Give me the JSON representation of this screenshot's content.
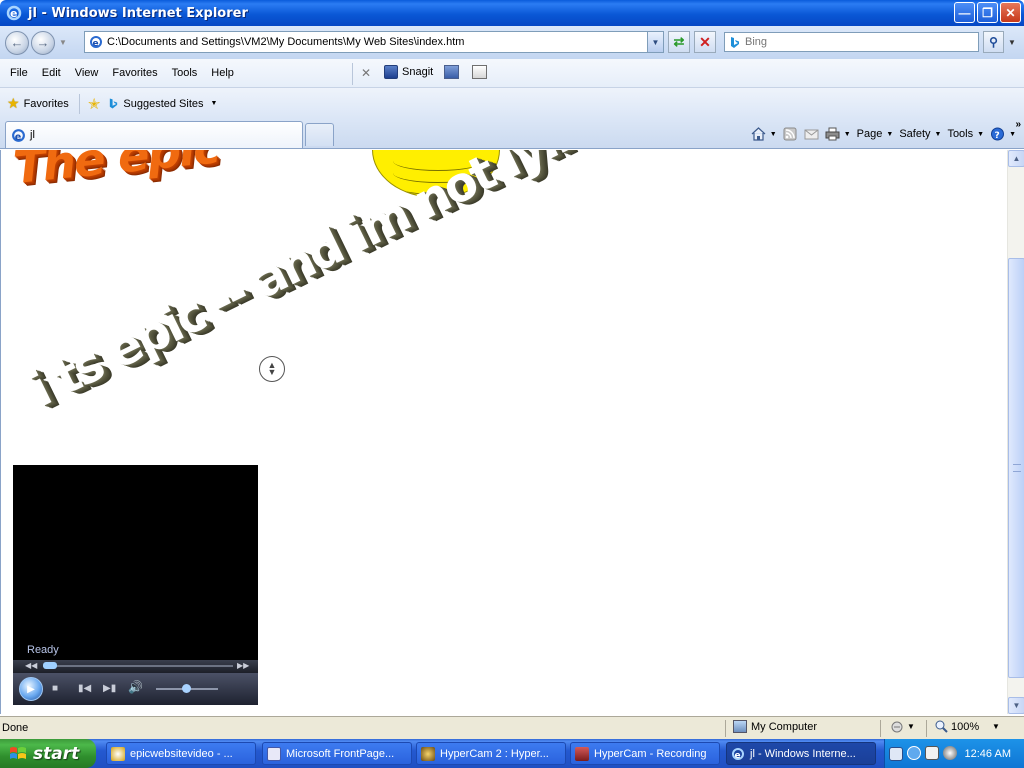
{
  "window": {
    "title": "jl - Windows Internet Explorer"
  },
  "address": {
    "url": "C:\\Documents and Settings\\VM2\\My Documents\\My Web Sites\\index.htm"
  },
  "search": {
    "placeholder": "Bing"
  },
  "menu": {
    "items": [
      "File",
      "Edit",
      "View",
      "Favorites",
      "Tools",
      "Help"
    ]
  },
  "toolbar": {
    "snagit_label": "Snagit"
  },
  "favorites_bar": {
    "favorites_label": "Favorites",
    "suggested_label": "Suggested Sites"
  },
  "tabs": [
    {
      "title": "jl"
    }
  ],
  "command_bar": {
    "page": "Page",
    "safety": "Safety",
    "tools": "Tools"
  },
  "content": {
    "art_text_top": "The epic",
    "art_text_main": "i ts epic -- and im not lying",
    "player": {
      "status": "Ready"
    }
  },
  "status_bar": {
    "status": "Done",
    "zone": "My Computer",
    "zoom": "100%"
  },
  "taskbar": {
    "start_label": "start",
    "tasks": [
      {
        "label": "epicwebsitevideo - ..."
      },
      {
        "label": "Microsoft FrontPage..."
      },
      {
        "label": "HyperCam 2 : Hyper..."
      },
      {
        "label": "HyperCam - Recording"
      },
      {
        "label": "jl - Windows Interne..."
      }
    ],
    "clock": "12:46 AM"
  }
}
